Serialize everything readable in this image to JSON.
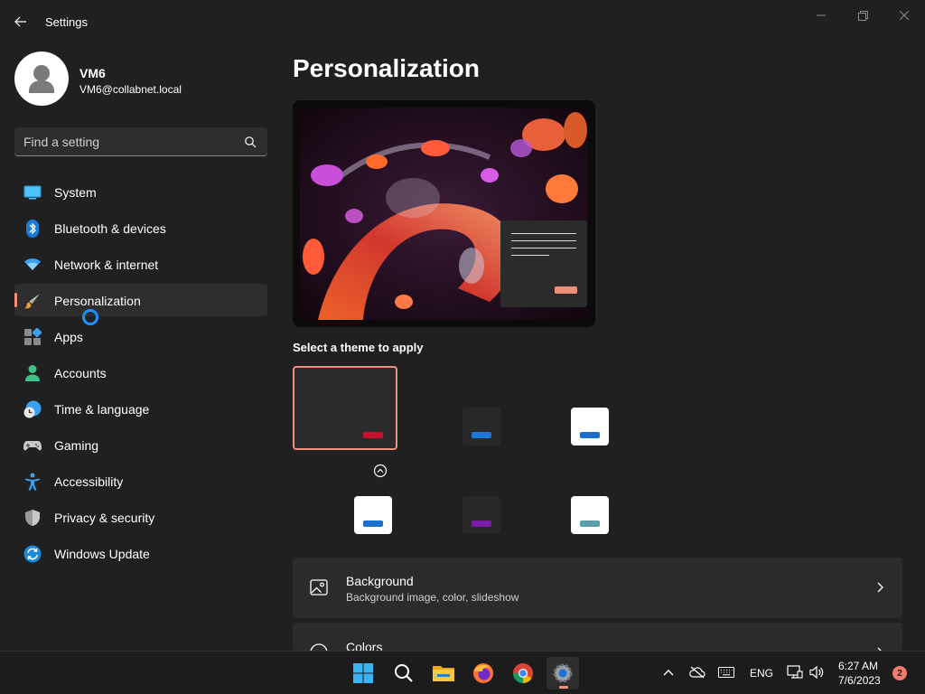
{
  "window": {
    "app_title": "Settings",
    "controls": [
      "minimize",
      "maximize",
      "close"
    ]
  },
  "profile": {
    "name": "VM6",
    "email": "VM6@collabnet.local"
  },
  "search": {
    "placeholder": "Find a setting"
  },
  "sidebar": {
    "items": [
      {
        "label": "System",
        "icon": "monitor-icon",
        "active": false
      },
      {
        "label": "Bluetooth & devices",
        "icon": "bluetooth-icon",
        "active": false
      },
      {
        "label": "Network & internet",
        "icon": "wifi-icon",
        "active": false
      },
      {
        "label": "Personalization",
        "icon": "paintbrush-icon",
        "active": true
      },
      {
        "label": "Apps",
        "icon": "apps-icon",
        "active": false
      },
      {
        "label": "Accounts",
        "icon": "person-icon",
        "active": false
      },
      {
        "label": "Time & language",
        "icon": "globe-clock-icon",
        "active": false
      },
      {
        "label": "Gaming",
        "icon": "gamepad-icon",
        "active": false
      },
      {
        "label": "Accessibility",
        "icon": "accessibility-icon",
        "active": false
      },
      {
        "label": "Privacy & security",
        "icon": "shield-icon",
        "active": false
      },
      {
        "label": "Windows Update",
        "icon": "update-icon",
        "active": false
      }
    ]
  },
  "main": {
    "title": "Personalization",
    "theme_section_label": "Select a theme to apply",
    "themes": [
      {
        "name": "dark",
        "selected": true
      },
      {
        "name": "dark-blue",
        "selected": false
      },
      {
        "name": "light-blue",
        "selected": false
      },
      {
        "name": "light-blue-2",
        "selected": false
      },
      {
        "name": "dark-purple",
        "selected": false
      },
      {
        "name": "light-teal",
        "selected": false
      }
    ],
    "cards": [
      {
        "title": "Background",
        "subtitle": "Background image, color, slideshow",
        "icon": "image-icon"
      },
      {
        "title": "Colors",
        "subtitle": "",
        "icon": "palette-icon"
      }
    ]
  },
  "taskbar": {
    "apps": [
      "windows-start",
      "search",
      "file-explorer",
      "firefox",
      "chrome",
      "settings"
    ],
    "active_app": "settings",
    "language": "ENG",
    "time": "6:27 AM",
    "date": "7/6/2023",
    "notification_count": "2"
  },
  "colors": {
    "accent": "#f1907a",
    "window_bg": "#202020",
    "card_bg": "#2b2b2b",
    "taskbar_bg": "#1c1c1c"
  }
}
